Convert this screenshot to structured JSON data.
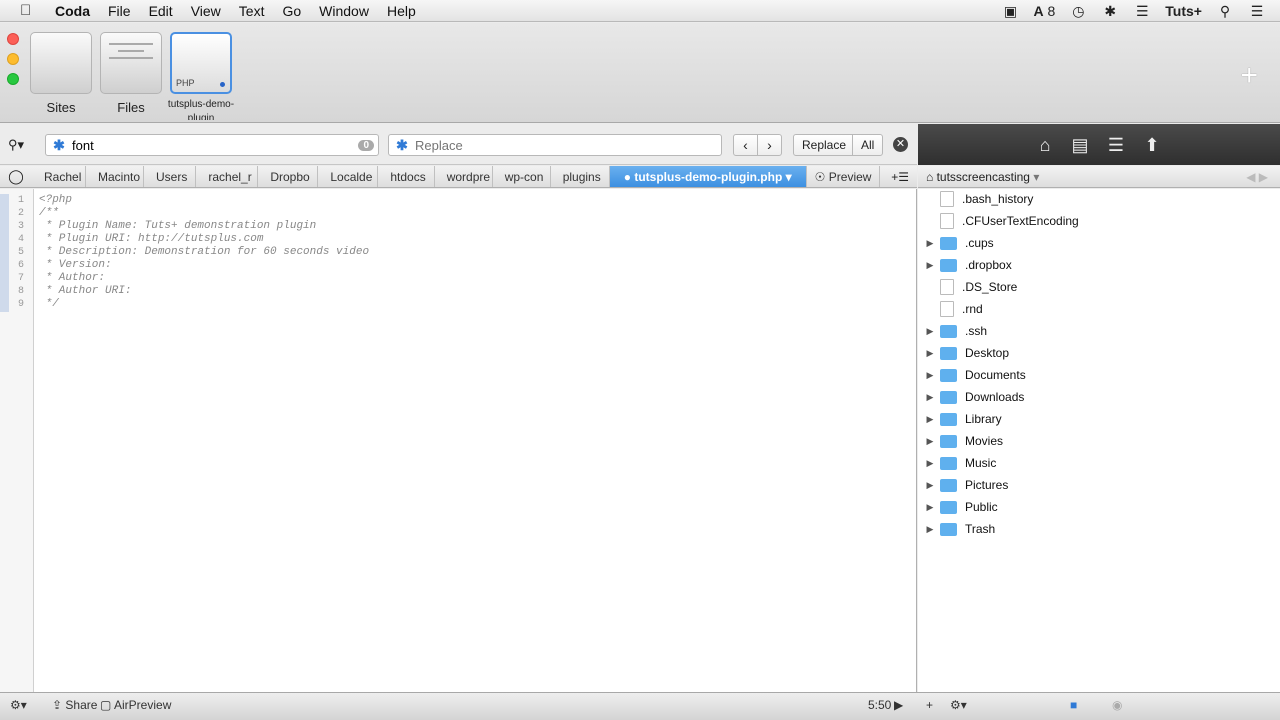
{
  "menubar": {
    "app": "Coda",
    "items": [
      "File",
      "Edit",
      "View",
      "Text",
      "Go",
      "Window",
      "Help"
    ],
    "status_badge_count": "8",
    "status_user": "Tuts+"
  },
  "toolbar": {
    "tiles": [
      {
        "label": "Sites"
      },
      {
        "label": "Files"
      },
      {
        "label": "tutsplus-demo-plugin",
        "badge": "PHP"
      }
    ]
  },
  "find": {
    "query": "font",
    "count": "0",
    "replace_placeholder": "Replace",
    "replace_label": "Replace",
    "all_label": "All"
  },
  "breadcrumb": {
    "crumbs": [
      "Rachel",
      "Macinto",
      "Users",
      "rachel_r",
      "Dropbo",
      "Localde",
      "htdocs",
      "wordpre",
      "wp-con",
      "plugins"
    ],
    "active_file": "tutsplus-demo-plugin.php",
    "preview_label": "Preview"
  },
  "editor": {
    "lines": [
      "<?php",
      "/**",
      " * Plugin Name: Tuts+ demonstration plugin",
      " * Plugin URI: http://tutsplus.com",
      " * Description: Demonstration for 60 seconds video",
      " * Version:",
      " * Author:",
      " * Author URI:",
      " */"
    ],
    "line_numbers": [
      "1",
      "2",
      "3",
      "4",
      "5",
      "6",
      "7",
      "8",
      "9"
    ]
  },
  "browser": {
    "root": "tutsscreencasting",
    "items": [
      {
        "name": ".bash_history",
        "type": "file",
        "expandable": false
      },
      {
        "name": ".CFUserTextEncoding",
        "type": "file",
        "expandable": false
      },
      {
        "name": ".cups",
        "type": "folder",
        "expandable": true
      },
      {
        "name": ".dropbox",
        "type": "folder",
        "expandable": true
      },
      {
        "name": ".DS_Store",
        "type": "file",
        "expandable": false
      },
      {
        "name": ".rnd",
        "type": "file",
        "expandable": false
      },
      {
        "name": ".ssh",
        "type": "folder",
        "expandable": true
      },
      {
        "name": "Desktop",
        "type": "folder",
        "expandable": true
      },
      {
        "name": "Documents",
        "type": "folder",
        "expandable": true
      },
      {
        "name": "Downloads",
        "type": "folder",
        "expandable": true
      },
      {
        "name": "Library",
        "type": "folder",
        "expandable": true
      },
      {
        "name": "Movies",
        "type": "folder",
        "expandable": true
      },
      {
        "name": "Music",
        "type": "folder",
        "expandable": true
      },
      {
        "name": "Pictures",
        "type": "folder",
        "expandable": true
      },
      {
        "name": "Public",
        "type": "folder",
        "expandable": true
      },
      {
        "name": "Trash",
        "type": "folder",
        "expandable": true
      }
    ]
  },
  "bottombar": {
    "share": "Share",
    "airpreview": "AirPreview",
    "cursor_pos": "5:50"
  },
  "colors": {
    "accent": "#3a8ee0",
    "folder": "#5fb0ee"
  }
}
